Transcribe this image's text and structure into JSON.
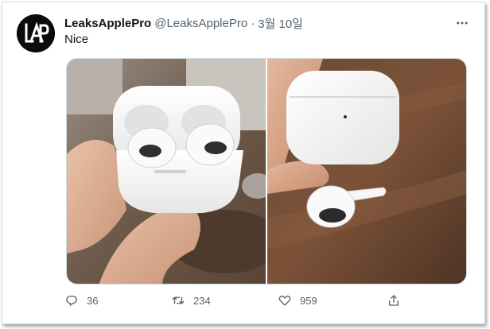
{
  "tweet": {
    "display_name": "LeaksApplePro",
    "handle": "@LeaksApplePro",
    "separator": "·",
    "date": "3월 10일",
    "text": "Nice",
    "avatar_icon": "lap-logo-icon",
    "more_icon": "more-icon"
  },
  "media": {
    "photos": [
      {
        "name": "photo-airpods-open-case",
        "alt_icon": "airpods-open-case-photo"
      },
      {
        "name": "photo-airpods-closed-case",
        "alt_icon": "airpods-closed-case-photo"
      }
    ]
  },
  "actions": {
    "reply": {
      "icon": "reply-icon",
      "count": "36"
    },
    "retweet": {
      "icon": "retweet-icon",
      "count": "234"
    },
    "like": {
      "icon": "like-icon",
      "count": "959"
    },
    "share": {
      "icon": "share-icon"
    }
  },
  "colors": {
    "text_primary": "#0f1419",
    "text_secondary": "#536471",
    "border": "#cfd9de"
  }
}
